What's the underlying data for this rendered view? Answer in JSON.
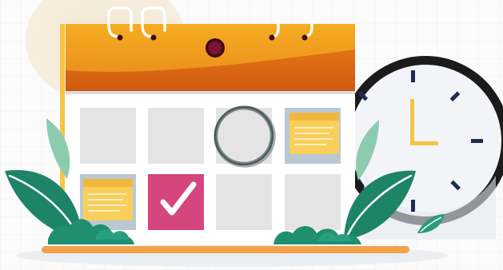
{
  "illustration": {
    "subject": "calendar-with-clock",
    "icons": [
      "calendar-icon",
      "clock-icon",
      "check-mark-icon",
      "sticky-note-icon",
      "leaf-icon"
    ],
    "colors": {
      "calendar_header": "#f2a21b",
      "calendar_header_dark": "#dd6b12",
      "calendar_stand": "#f6c545",
      "tile": "#e4e4e4",
      "note_yellow": "#f8cf5a",
      "note_background": "#b9c8d4",
      "checked_tile": "#d4467d",
      "circle_mark": "#4c5b5d",
      "clock_frame": "#222222",
      "clock_face": "#f2f4f8",
      "clock_hand": "#f3c445",
      "clock_tick": "#1d2a55",
      "leaf_green": "#1d8468",
      "leaf_light": "#8dcbb1",
      "ground_orange": "#f4a149",
      "background_blob": "#f5ebd9"
    },
    "clock_time": "3:00"
  }
}
